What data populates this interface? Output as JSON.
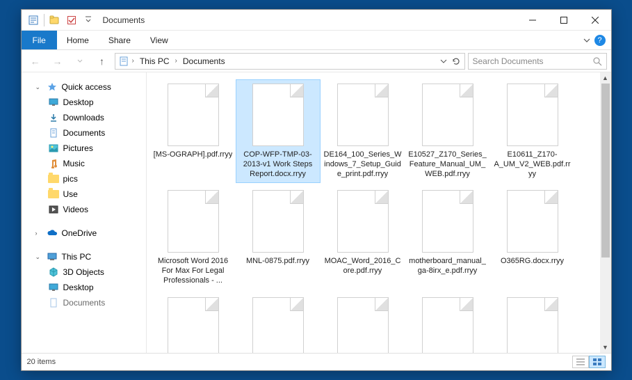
{
  "window": {
    "title": "Documents"
  },
  "ribbon": {
    "file": "File",
    "tabs": [
      "Home",
      "Share",
      "View"
    ]
  },
  "breadcrumb": {
    "items": [
      "This PC",
      "Documents"
    ]
  },
  "search": {
    "placeholder": "Search Documents"
  },
  "sidebar": {
    "quick_access": {
      "label": "Quick access"
    },
    "quick_items": [
      {
        "label": "Desktop",
        "icon": "desktop"
      },
      {
        "label": "Downloads",
        "icon": "downloads"
      },
      {
        "label": "Documents",
        "icon": "documents"
      },
      {
        "label": "Pictures",
        "icon": "pictures"
      },
      {
        "label": "Music",
        "icon": "music"
      },
      {
        "label": "pics",
        "icon": "folder"
      },
      {
        "label": "Use",
        "icon": "folder"
      },
      {
        "label": "Videos",
        "icon": "videos"
      }
    ],
    "onedrive": {
      "label": "OneDrive"
    },
    "thispc": {
      "label": "This PC"
    },
    "pc_items": [
      {
        "label": "3D Objects",
        "icon": "3d"
      },
      {
        "label": "Desktop",
        "icon": "desktop"
      },
      {
        "label": "Documents",
        "icon": "documents"
      }
    ]
  },
  "files": [
    {
      "name": "[MS-OGRAPH].pdf.rryy"
    },
    {
      "name": "COP-WFP-TMP-03-2013-v1 Work Steps Report.docx.rryy",
      "selected": true
    },
    {
      "name": "DE164_100_Series_Windows_7_Setup_Guide_print.pdf.rryy"
    },
    {
      "name": "E10527_Z170_Series_Feature_Manual_UM_WEB.pdf.rryy"
    },
    {
      "name": "E10611_Z170-A_UM_V2_WEB.pdf.rryy"
    },
    {
      "name": "Microsoft Word 2016 For Max For Legal Professionals - ..."
    },
    {
      "name": "MNL-0875.pdf.rryy"
    },
    {
      "name": "MOAC_Word_2016_Core.pdf.rryy"
    },
    {
      "name": "motherboard_manual_ga-8irx_e.pdf.rryy"
    },
    {
      "name": "O365RG.docx.rryy"
    },
    {
      "name": ""
    },
    {
      "name": ""
    },
    {
      "name": ""
    },
    {
      "name": ""
    },
    {
      "name": ""
    }
  ],
  "status": {
    "count": "20 items"
  }
}
